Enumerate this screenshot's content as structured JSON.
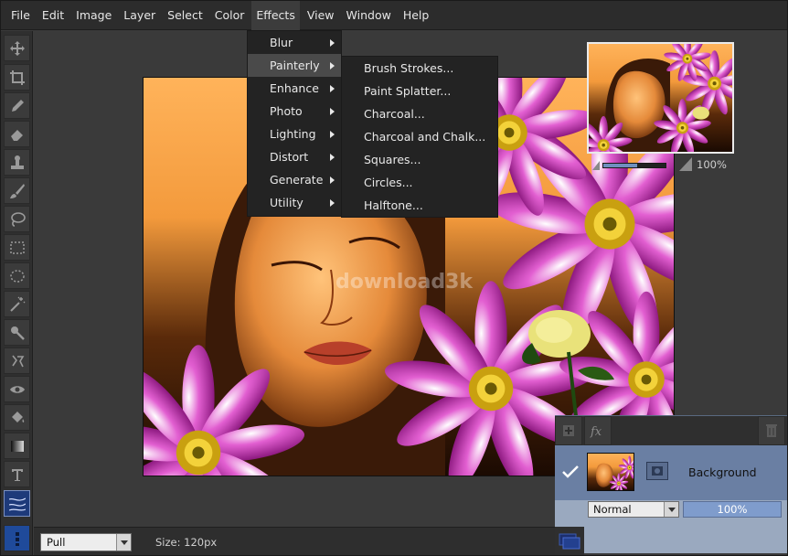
{
  "menubar": {
    "items": [
      "File",
      "Edit",
      "Image",
      "Layer",
      "Select",
      "Color",
      "Effects",
      "View",
      "Window",
      "Help"
    ],
    "active": "Effects"
  },
  "effects_menu": {
    "items": [
      "Blur",
      "Painterly",
      "Enhance",
      "Photo",
      "Lighting",
      "Distort",
      "Generate",
      "Utility"
    ],
    "hovered": "Painterly"
  },
  "painterly_submenu": {
    "items": [
      "Brush Strokes...",
      "Paint Splatter...",
      "Charcoal...",
      "Charcoal and Chalk...",
      "Squares...",
      "Circles...",
      "Halftone..."
    ]
  },
  "canvas": {
    "watermark": "download3k"
  },
  "navigator": {
    "zoom_label": "100%",
    "zoom_fraction": 0.55
  },
  "layers": {
    "layer_name": "Background",
    "visible": true,
    "blend_mode": "Normal",
    "opacity": "100%"
  },
  "statusbar": {
    "brush_mode": "Pull",
    "size_label": "Size: 120px"
  },
  "tools": [
    "move-icon",
    "crop-icon",
    "pencil-icon",
    "eraser-icon",
    "stamp-icon",
    "brush-icon",
    "lasso-icon",
    "marquee-rect-icon",
    "marquee-ellipse-icon",
    "magic-wand-icon",
    "smudge-icon",
    "dodge-icon",
    "eye-icon",
    "bucket-icon",
    "gradient-icon",
    "type-icon"
  ],
  "colors": {
    "accent_blue": "#1f4a9a",
    "menu_bg": "#232323",
    "opacity_fill": "#7f9ccc"
  }
}
